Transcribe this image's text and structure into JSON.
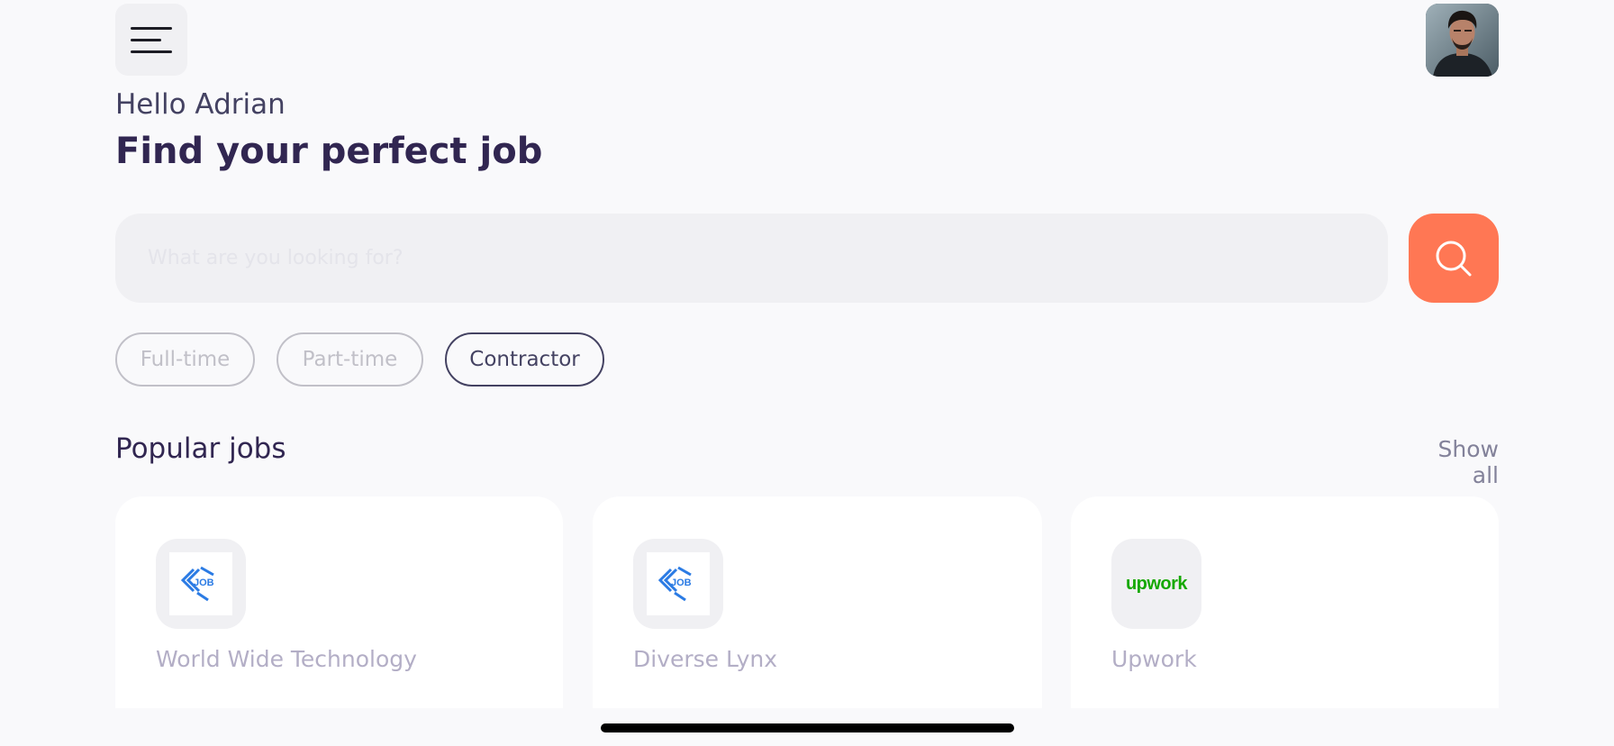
{
  "header": {
    "menu_icon": "menu-icon",
    "avatar": "profile-photo"
  },
  "welcome": {
    "greeting": "Hello Adrian",
    "headline": "Find your perfect job"
  },
  "search": {
    "placeholder": "What are you looking for?",
    "value": "",
    "button_icon": "search-icon"
  },
  "job_types": [
    {
      "label": "Full-time",
      "active": false
    },
    {
      "label": "Part-time",
      "active": false
    },
    {
      "label": "Contractor",
      "active": true
    }
  ],
  "popular": {
    "title": "Popular jobs",
    "show_all": "Show all",
    "jobs": [
      {
        "company": "World Wide Technology",
        "logo": "job-logo"
      },
      {
        "company": "Diverse Lynx",
        "logo": "job-logo"
      },
      {
        "company": "Upwork",
        "logo": "upwork-logo",
        "logo_text": "upwork"
      }
    ]
  },
  "colors": {
    "primary": "#312651",
    "tertiary": "#FF7754",
    "gray": "#83829A",
    "gray2": "#C1C0C8",
    "lightWhite": "#F9F9FB",
    "upwork": "#14A800"
  }
}
